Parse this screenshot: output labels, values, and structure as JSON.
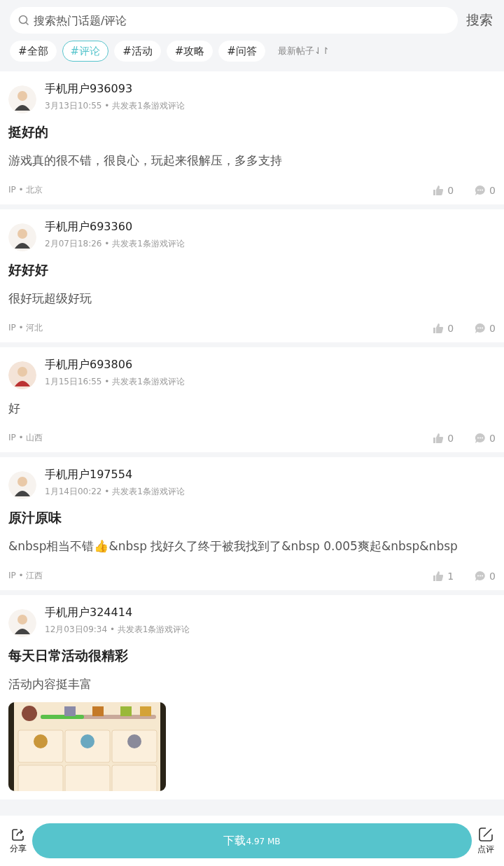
{
  "search": {
    "placeholder": "搜索热门话题/评论",
    "button": "搜索"
  },
  "tags": [
    {
      "label": "#全部",
      "selected": false
    },
    {
      "label": "#评论",
      "selected": true
    },
    {
      "label": "#活动",
      "selected": false
    },
    {
      "label": "#攻略",
      "selected": false
    },
    {
      "label": "#问答",
      "selected": false
    }
  ],
  "sort": {
    "label": "最新帖子",
    "icon": "⇃↾"
  },
  "posts": [
    {
      "user": "手机用户936093",
      "meta": "3月13日10:55 • 共发表1条游戏评论",
      "title": "挺好的",
      "body": "游戏真的很不错，很良心，玩起来很解压，多多支持",
      "ip": "IP • 北京",
      "likes": "0",
      "comments": "0"
    },
    {
      "user": "手机用户693360",
      "meta": "2月07日18:26 • 共发表1条游戏评论",
      "title": "好好好",
      "body": "很好玩超级好玩",
      "ip": "IP • 河北",
      "likes": "0",
      "comments": "0"
    },
    {
      "user": "手机用户693806",
      "meta": "1月15日16:55 • 共发表1条游戏评论",
      "body": "好",
      "ip": "IP • 山西",
      "likes": "0",
      "comments": "0"
    },
    {
      "user": "手机用户197554",
      "meta": "1月14日00:22 • 共发表1条游戏评论",
      "title": "原汁原味",
      "body": "&nbsp相当不错👍&nbsp 找好久了终于被我找到了&nbsp 0.005爽起&nbsp&nbsp",
      "ip": "IP • 江西",
      "likes": "1",
      "comments": "0"
    },
    {
      "user": "手机用户324414",
      "meta": "12月03日09:34 • 共发表1条游戏评论",
      "title": "每天日常活动很精彩",
      "body": "活动内容挺丰富"
    }
  ],
  "bottom_bar": {
    "share": "分享",
    "download": "下载",
    "size": "4.97 MB",
    "review": "点评"
  }
}
